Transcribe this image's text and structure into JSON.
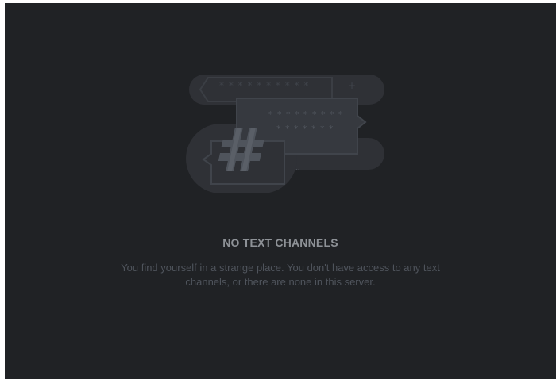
{
  "empty_state": {
    "illustration_icon": "no-text-channels-illustration",
    "title": "NO TEXT CHANNELS",
    "description": "You find yourself in a strange place. You don't have access to any text channels, or there are none in this server."
  },
  "colors": {
    "background": "#202225",
    "illustration_base": "#2f3136",
    "illustration_panel": "#36393f",
    "illustration_stroke": "#40444b",
    "title": "#8e9297",
    "description": "#4f545c"
  }
}
